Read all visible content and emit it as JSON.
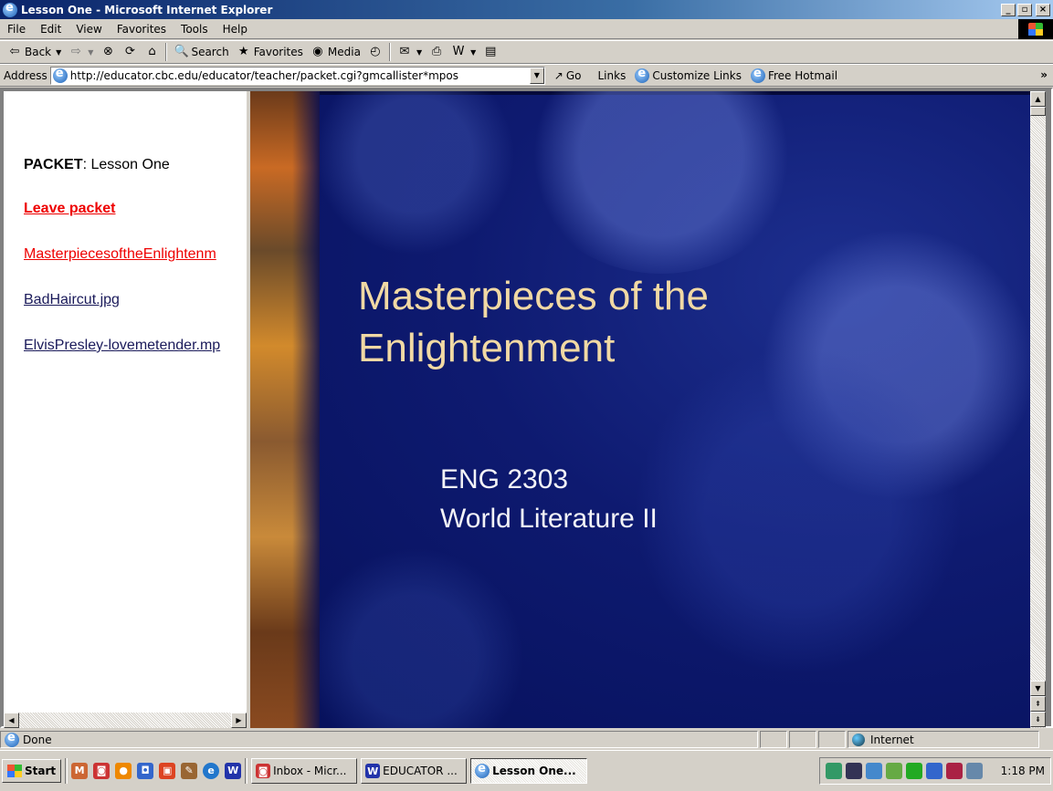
{
  "window": {
    "title": "Lesson One - Microsoft Internet Explorer"
  },
  "menu": [
    "File",
    "Edit",
    "View",
    "Favorites",
    "Tools",
    "Help"
  ],
  "toolbar": {
    "back": "Back",
    "search": "Search",
    "favorites": "Favorites",
    "media": "Media"
  },
  "address": {
    "label": "Address",
    "url": "http://educator.cbc.edu/educator/teacher/packet.cgi?gmcallister*mpos",
    "go": "Go",
    "links_label": "Links",
    "links": [
      "Customize Links",
      "Free Hotmail"
    ]
  },
  "left_frame": {
    "packet_label": "PACKET",
    "packet_value": ": Lesson One",
    "leave": "Leave packet",
    "items": [
      "MasterpiecesoftheEnlightenm",
      "BadHaircut.jpg",
      "ElvisPresley-lovemetender.mp"
    ]
  },
  "slide": {
    "title_line1": "Masterpieces of the",
    "title_line2": "Enlightenment",
    "sub_line1": "ENG 2303",
    "sub_line2": "World Literature II"
  },
  "status": {
    "text": "Done",
    "zone": "Internet"
  },
  "taskbar": {
    "start": "Start",
    "tasks": [
      "Inbox - Micr...",
      "EDUCATOR ...",
      "Lesson One..."
    ],
    "clock": "1:18 PM"
  }
}
